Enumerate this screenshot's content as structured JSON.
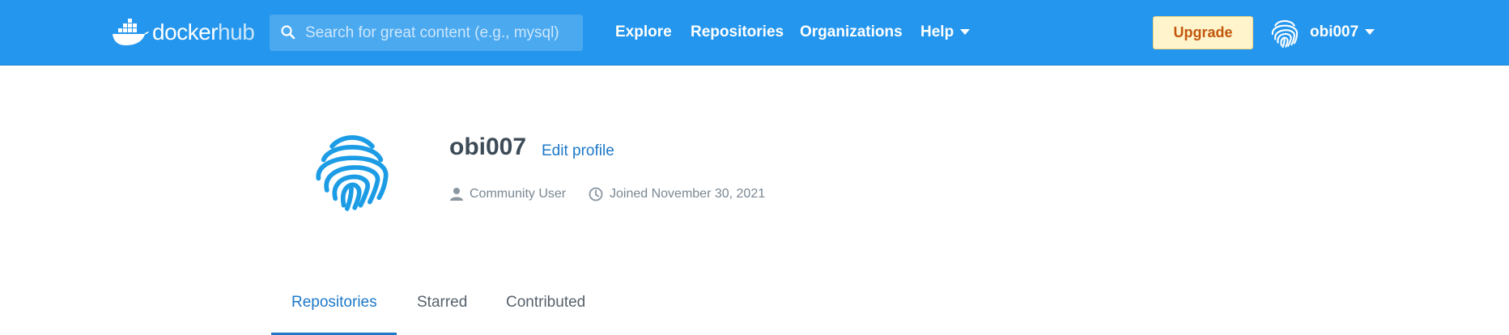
{
  "colors": {
    "topbar": "#2496ed",
    "accent": "#1d78c9",
    "upgrade_bg": "#fff4cc",
    "upgrade_text": "#c2570c",
    "avatar": "#1d9ce6"
  },
  "header": {
    "logo": {
      "word1": "docker",
      "word2": "hub",
      "icon": "docker-whale-icon"
    },
    "search": {
      "placeholder": "Search for great content (e.g., mysql)",
      "value": "",
      "icon": "search-icon"
    },
    "nav": {
      "explore": "Explore",
      "repositories": "Repositories",
      "organizations": "Organizations",
      "help": "Help"
    },
    "upgrade_label": "Upgrade",
    "user": {
      "name": "obi007",
      "avatar_icon": "fingerprint-icon"
    }
  },
  "profile": {
    "username": "obi007",
    "edit_label": "Edit profile",
    "role": "Community User",
    "joined": "Joined November 30, 2021",
    "avatar_icon": "fingerprint-icon"
  },
  "tabs": [
    {
      "label": "Repositories",
      "active": true
    },
    {
      "label": "Starred",
      "active": false
    },
    {
      "label": "Contributed",
      "active": false
    }
  ]
}
